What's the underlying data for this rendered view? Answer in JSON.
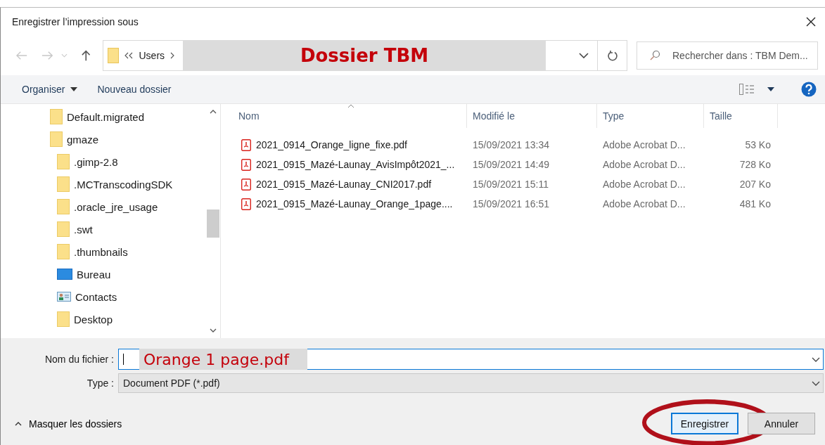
{
  "window": {
    "title": "Enregistrer l’impression sous"
  },
  "address": {
    "crumbs": [
      "Users"
    ],
    "annotation": "Dossier TBM"
  },
  "search": {
    "placeholder": "Rechercher dans : TBM Dem..."
  },
  "toolbar": {
    "organize": "Organiser",
    "new_folder": "Nouveau dossier"
  },
  "tree": [
    {
      "label": "Default.migrated",
      "kind": "folder"
    },
    {
      "label": "gmaze",
      "kind": "folder",
      "children": [
        {
          "label": ".gimp-2.8",
          "kind": "folder"
        },
        {
          "label": ".MCTranscodingSDK",
          "kind": "folder"
        },
        {
          "label": ".oracle_jre_usage",
          "kind": "folder"
        },
        {
          "label": ".swt",
          "kind": "folder"
        },
        {
          "label": ".thumbnails",
          "kind": "folder"
        },
        {
          "label": "Bureau",
          "kind": "desktop"
        },
        {
          "label": "Contacts",
          "kind": "contacts"
        },
        {
          "label": "Desktop",
          "kind": "folder"
        }
      ]
    }
  ],
  "table": {
    "columns": [
      "Nom",
      "Modifié le",
      "Type",
      "Taille"
    ],
    "rows": [
      {
        "name": "2021_0914_Orange_ligne_fixe.pdf",
        "modified": "15/09/2021 13:34",
        "type": "Adobe Acrobat D...",
        "size": "53 Ko"
      },
      {
        "name": "2021_0915_Mazé-Launay_AvisImpôt2021_...",
        "modified": "15/09/2021 14:49",
        "type": "Adobe Acrobat D...",
        "size": "728 Ko"
      },
      {
        "name": "2021_0915_Mazé-Launay_CNI2017.pdf",
        "modified": "15/09/2021 15:11",
        "type": "Adobe Acrobat D...",
        "size": "207 Ko"
      },
      {
        "name": "2021_0915_Mazé-Launay_Orange_1page....",
        "modified": "15/09/2021 16:51",
        "type": "Adobe Acrobat D...",
        "size": "481 Ko"
      }
    ]
  },
  "filename": {
    "label": "Nom du fichier :",
    "annotation": "Orange 1 page.pdf"
  },
  "filetype": {
    "label": "Type :",
    "value": "Document PDF (*.pdf)"
  },
  "hide_folders": "Masquer les dossiers",
  "buttons": [
    {
      "label": "Enregistrer",
      "default": true,
      "circled": true
    },
    {
      "label": "Annuler",
      "default": false,
      "circled": false
    }
  ]
}
